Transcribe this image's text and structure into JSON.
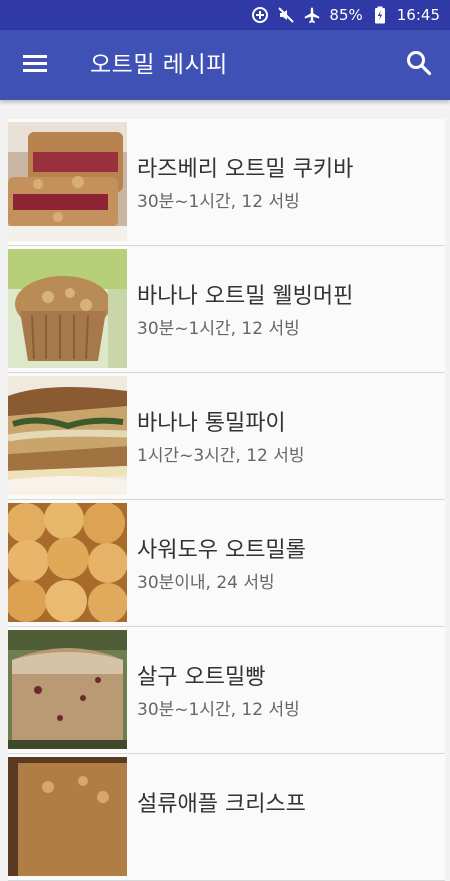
{
  "status": {
    "battery": "85%",
    "time": "16:45"
  },
  "header": {
    "title": "오트밀 레시피"
  },
  "icons": {
    "menu": "menu-icon",
    "search": "search-icon"
  },
  "colors": {
    "appbar": "#3f51b5",
    "statusbar": "#2f3aa6",
    "background": "#f2f2f2"
  },
  "recipes": [
    {
      "title": "라즈베리 오트밀 쿠키바",
      "meta": "30분~1시간, 12 서빙"
    },
    {
      "title": "바나나 오트밀 웰빙머핀",
      "meta": "30분~1시간, 12 서빙"
    },
    {
      "title": "바나나 통밀파이",
      "meta": "1시간~3시간, 12 서빙"
    },
    {
      "title": "사워도우 오트밀롤",
      "meta": "30분이내, 24 서빙"
    },
    {
      "title": "살구 오트밀빵",
      "meta": "30분~1시간, 12 서빙"
    },
    {
      "title": "설류애플 크리스프",
      "meta": ""
    }
  ]
}
